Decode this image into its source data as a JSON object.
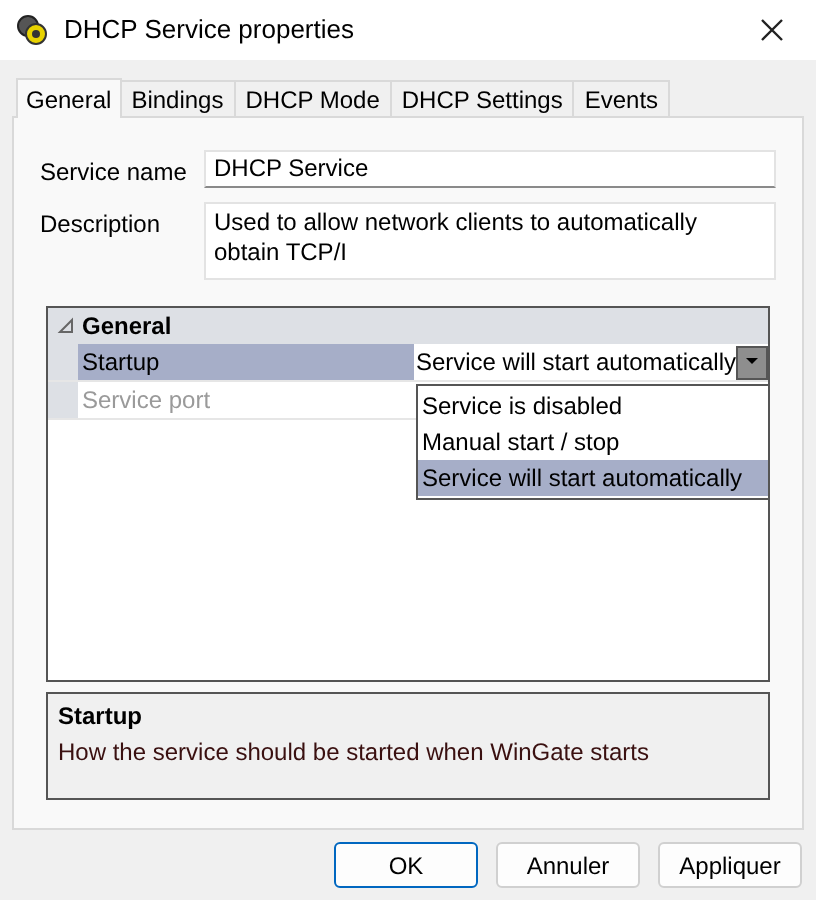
{
  "window": {
    "title": "DHCP Service properties"
  },
  "tabs": [
    {
      "label": "General",
      "selected": true
    },
    {
      "label": "Bindings",
      "selected": false
    },
    {
      "label": "DHCP Mode",
      "selected": false
    },
    {
      "label": "DHCP Settings",
      "selected": false
    },
    {
      "label": "Events",
      "selected": false
    }
  ],
  "fields": [
    {
      "label": "Service name",
      "value": "DHCP Service",
      "kind": "line"
    },
    {
      "label": "Description",
      "value": "Used to allow network clients to automatically obtain TCP/I",
      "kind": "multiline"
    }
  ],
  "property_grid": {
    "category": {
      "label": "General",
      "expanded": true
    },
    "properties": [
      {
        "name": "Startup",
        "value": "Service will start automatically",
        "selected": true,
        "disabled": false
      },
      {
        "name": "Service port",
        "selected": false,
        "disabled": true
      }
    ],
    "dropdown": {
      "options": [
        {
          "label": "Service is disabled",
          "selected": false
        },
        {
          "label": "Manual start / stop",
          "selected": false
        },
        {
          "label": "Service will start automatically",
          "selected": true
        }
      ]
    }
  },
  "help": {
    "title": "Startup",
    "text": "How the service should be started when WinGate starts"
  },
  "buttons": [
    {
      "label": "OK",
      "default": true
    },
    {
      "label": "Annuler",
      "default": false
    },
    {
      "label": "Appliquer",
      "default": false
    }
  ]
}
